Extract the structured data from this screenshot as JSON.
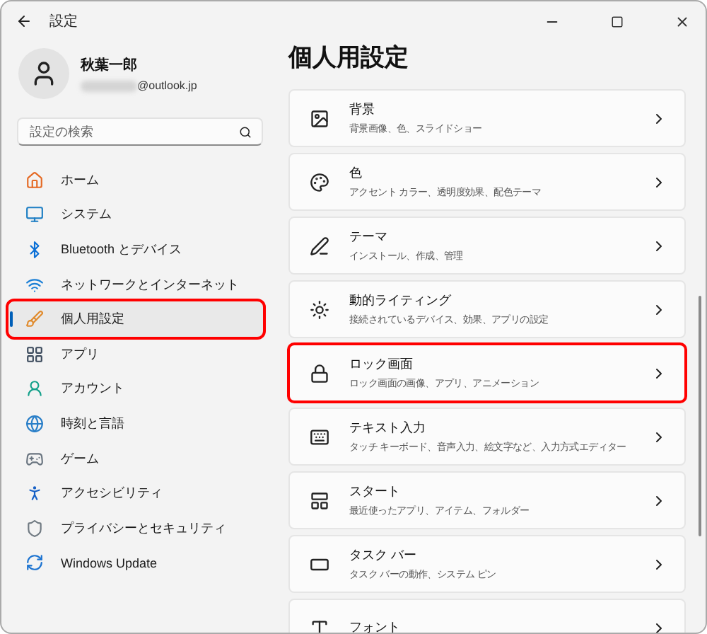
{
  "window": {
    "title": "設定"
  },
  "account": {
    "name": "秋葉一郎",
    "email": "@outlook.jp"
  },
  "search": {
    "placeholder": "設定の検索"
  },
  "sidebar": {
    "items": [
      {
        "label": "ホーム",
        "selected": false,
        "highlighted": false
      },
      {
        "label": "システム",
        "selected": false,
        "highlighted": false
      },
      {
        "label": "Bluetooth とデバイス",
        "selected": false,
        "highlighted": false
      },
      {
        "label": "ネットワークとインターネット",
        "selected": false,
        "highlighted": false
      },
      {
        "label": "個人用設定",
        "selected": true,
        "highlighted": true
      },
      {
        "label": "アプリ",
        "selected": false,
        "highlighted": false
      },
      {
        "label": "アカウント",
        "selected": false,
        "highlighted": false
      },
      {
        "label": "時刻と言語",
        "selected": false,
        "highlighted": false
      },
      {
        "label": "ゲーム",
        "selected": false,
        "highlighted": false
      },
      {
        "label": "アクセシビリティ",
        "selected": false,
        "highlighted": false
      },
      {
        "label": "プライバシーとセキュリティ",
        "selected": false,
        "highlighted": false
      },
      {
        "label": "Windows Update",
        "selected": false,
        "highlighted": false
      }
    ]
  },
  "page": {
    "title": "個人用設定",
    "cards": [
      {
        "title": "背景",
        "subtitle": "背景画像、色、スライドショー",
        "highlighted": false
      },
      {
        "title": "色",
        "subtitle": "アクセント カラー、透明度効果、配色テーマ",
        "highlighted": false
      },
      {
        "title": "テーマ",
        "subtitle": "インストール、作成、管理",
        "highlighted": false
      },
      {
        "title": "動的ライティング",
        "subtitle": "接続されているデバイス、効果、アプリの設定",
        "highlighted": false
      },
      {
        "title": "ロック画面",
        "subtitle": "ロック画面の画像、アプリ、アニメーション",
        "highlighted": true
      },
      {
        "title": "テキスト入力",
        "subtitle": "タッチ キーボード、音声入力、絵文字など、入力方式エディター",
        "highlighted": false
      },
      {
        "title": "スタート",
        "subtitle": "最近使ったアプリ、アイテム、フォルダー",
        "highlighted": false
      },
      {
        "title": "タスク バー",
        "subtitle": "タスク バーの動作、システム ピン",
        "highlighted": false
      },
      {
        "title": "フォント",
        "highlighted": false
      }
    ]
  }
}
